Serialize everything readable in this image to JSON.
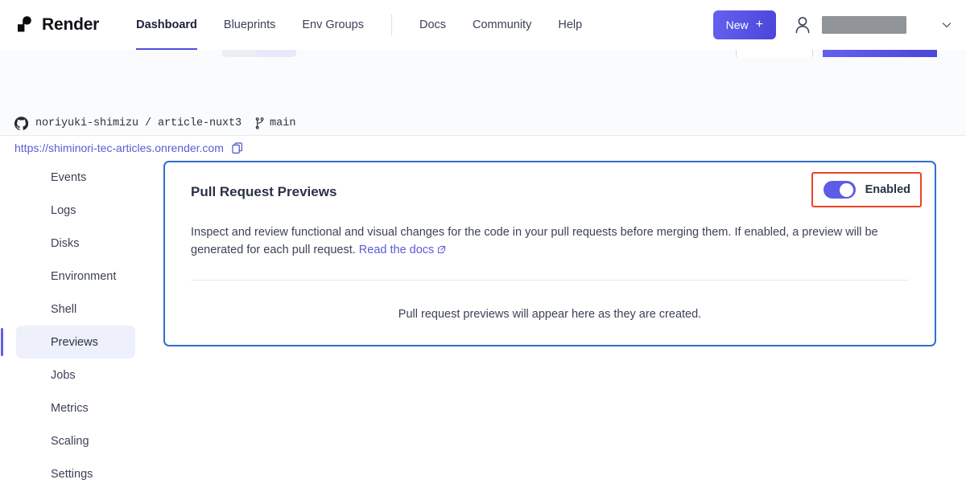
{
  "brand": {
    "name": "Render",
    "logo_icon": "render-logo-icon"
  },
  "topnav": {
    "links": [
      {
        "label": "Dashboard",
        "active": true
      },
      {
        "label": "Blueprints",
        "active": false
      },
      {
        "label": "Env Groups",
        "active": false
      },
      {
        "label": "Docs",
        "active": false
      },
      {
        "label": "Community",
        "active": false
      },
      {
        "label": "Help",
        "active": false
      }
    ],
    "new_button": {
      "label": "New",
      "plus": "+"
    },
    "account": {
      "avatar_icon": "person-icon",
      "name_redacted": "",
      "chevron_icon": "chevron-down-icon"
    }
  },
  "subheader": {
    "github_icon": "github-icon",
    "repo_owner": "noriyuki-shimizu",
    "repo_separator": "/",
    "repo_name": "article-nuxt3",
    "repo_path": "noriyuki-shimizu / article-nuxt3",
    "branch_icon": "git-branch-icon",
    "branch": "main",
    "service_url": "https://shiminori-tec-articles.onrender.com",
    "copy_icon": "copy-icon"
  },
  "sidebar": {
    "items": [
      {
        "label": "Events",
        "active": false
      },
      {
        "label": "Logs",
        "active": false
      },
      {
        "label": "Disks",
        "active": false
      },
      {
        "label": "Environment",
        "active": false
      },
      {
        "label": "Shell",
        "active": false
      },
      {
        "label": "Previews",
        "active": true
      },
      {
        "label": "Jobs",
        "active": false
      },
      {
        "label": "Metrics",
        "active": false
      },
      {
        "label": "Scaling",
        "active": false
      },
      {
        "label": "Settings",
        "active": false
      }
    ]
  },
  "card": {
    "title": "Pull Request Previews",
    "toggle": {
      "state_label": "Enabled",
      "on": true
    },
    "description_part1": "Inspect and review functional and visual changes for the code in your pull requests before merging them. If enabled, a preview will be generated for each pull request.",
    "docs_link_label": "Read the docs",
    "external_icon": "external-link-icon",
    "empty_state": "Pull request previews will appear here as they are created."
  },
  "colors": {
    "accent_indigo": "#5b5bd6",
    "toggle_on": "#5d5ce6",
    "card_border_blue": "#2f6fce",
    "highlight_red": "#f04124",
    "text_primary": "#2b3245",
    "text_secondary": "#3c4257",
    "subheader_bg": "#fafbfc",
    "sidebar_active_bg": "#eef0fb"
  }
}
